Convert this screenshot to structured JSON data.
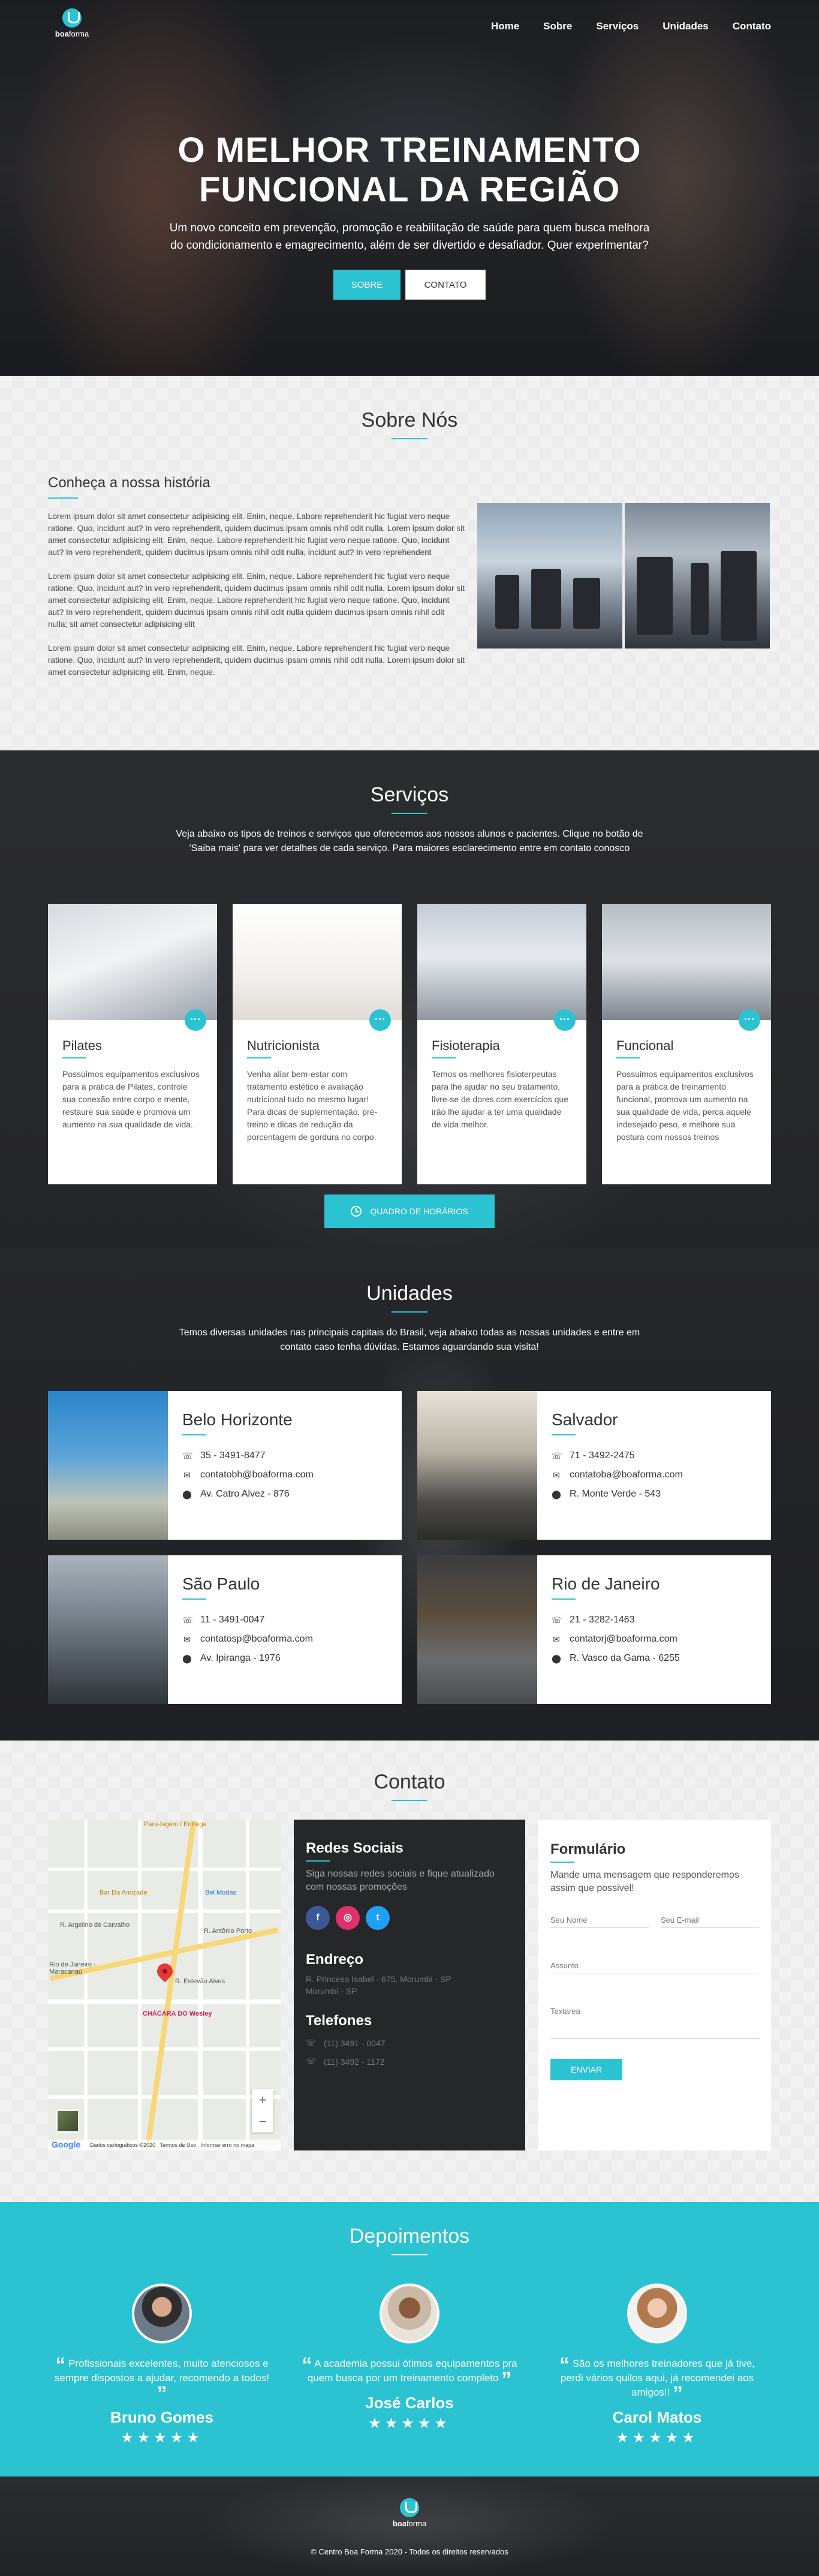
{
  "nav": {
    "logo_bold": "boa",
    "logo_regular": "forma",
    "items": [
      "Home",
      "Sobre",
      "Serviços",
      "Unidades",
      "Contato"
    ]
  },
  "hero": {
    "title_line1": "O MELHOR TREINAMENTO",
    "title_line2": "FUNCIONAL DA REGIÃO",
    "subtitle": "Um novo conceito em prevenção, promoção e reabilitação de saúde para quem busca melhora do condicionamento e emagrecimento, além de ser divertido e desafiador. Quer experimentar?",
    "btn_primary": "SOBRE",
    "btn_secondary": "CONTATO"
  },
  "sobre": {
    "title": "Sobre Nós",
    "subtitle": "Conheça a nossa história",
    "paragraphs": [
      "Lorem ipsum dolor sit amet consectetur adipisicing elit. Enim, neque. Labore reprehenderit hic fugiat vero neque ratione. Quo, incidunt aut? In vero reprehenderit, quidem ducimus ipsam omnis nihil odit nulla. Lorem ipsum dolor sit amet consectetur adipisicing elit. Enim, neque. Labore reprehenderit hic fugiat vero neque ratione. Quo, incidunt aut? In vero reprehenderit, quidem ducimus ipsam omnis nihil odit nulla, incidunt aut? In vero reprehendent",
      "Lorem ipsum dolor sit amet consectetur adipisicing elit. Enim, neque. Labore reprehenderit hic fugiat vero neque ratione. Quo, incidunt aut? In vero reprehenderit, quidem ducimus ipsam omnis nihil odit nulla. Lorem ipsum dolor sit amet consectetur adipisicing elit. Enim, neque. Labore reprehenderit hic fugiat vero neque ratione. Quo, incidunt aut? In vero reprehenderit, quidem ducimus ipsam omnis nihil odit nulla quidem ducimus ipsam omnis nihil odit nulla; sit amet consectetur adipisicing elit",
      "Lorem ipsum dolor sit amet consectetur adipisicing elit. Enim, neque. Labore reprehenderit hic fugiat vero neque ratione. Quo, incidunt aut? In vero reprehenderit, quidem ducimus ipsam omnis nihil odit nulla. Lorem ipsum dolor sit amet consectetur adipisicing elit. Enim, neque."
    ]
  },
  "servicos": {
    "title": "Serviços",
    "description": "Veja abaixo os tipos de treinos e serviços que oferecemos aos nossos alunos e pacientes. Clique no botão de 'Saiba mais' para ver detalhes de cada serviço. Para maiores esclarecimento entre em contato conosco",
    "more_icon": "···",
    "cards": [
      {
        "title": "Pilates",
        "text": "Possuimos equipamentos exclusivos para a prática de Pilates, controle sua conexão entre corpo e mente, restaure sua saúde e promova um aumento na sua qualidade de vida."
      },
      {
        "title": "Nutricionista",
        "text": "Venha aliar bem-estar com tratamento estético e avaliação nutricional tudo no mesmo lugar! Para dicas de suplementação, pré-treino e dicas de redução da porcentagem de gordura no corpo."
      },
      {
        "title": "Fisioterapia",
        "text": "Temos os melhores fisioterpeutas para lhe ajudar no seu tratamento, livre-se de dores com exercícios que irão lhe ajudar a ter uma qualidade de vida melhor."
      },
      {
        "title": "Funcional",
        "text": "Possuimos equipamentos exclusivos para a prática de treinamento funcional, promova um aumento na sua qualidade de vida, perca aquele indesejado peso, e melhore sua postura com nossos treinos"
      }
    ],
    "schedule_button": "QUADRO DE HORÁRIOS"
  },
  "unidades": {
    "title": "Unidades",
    "description": "Temos diversas unidades nas principais capitais do Brasil, veja abaixo todas as nossas unidades e entre em contato caso tenha dúvidas. Estamos aguardando sua visita!",
    "items": [
      {
        "city": "Belo Horizonte",
        "phone": "35 - 3491-8477",
        "email": "contatobh@boaforma.com",
        "address": "Av. Catro Alvez - 876"
      },
      {
        "city": "Salvador",
        "phone": "71 - 3492-2475",
        "email": "contatoba@boaforma.com",
        "address": "R. Monte Verde - 543"
      },
      {
        "city": "São Paulo",
        "phone": "11 - 3491-0047",
        "email": "contatosp@boaforma.com",
        "address": "Av. Ipiranga - 1976"
      },
      {
        "city": "Rio de Janeiro",
        "phone": "21 - 3282-1463",
        "email": "contatorj@boaforma.com",
        "address": "R. Vasco da Gama - 6255"
      }
    ]
  },
  "contato": {
    "title": "Contato",
    "map": {
      "labels": [
        "Para-lagem / Entrega",
        "Bar Da Amizade",
        "Bel Modas",
        "R. Argelino de Carvalho",
        "R. Antônio Porto",
        "Rio de Janeiro - Maracanaú",
        "R. Estevão Alves",
        "CHÁCARA DO Wesley",
        "Dados cartográficos ©2020",
        "Termos de Uso",
        "Informar erro no mapa",
        "Google"
      ],
      "zoom_in": "+",
      "zoom_out": "−"
    },
    "social": {
      "title": "Redes Sociais",
      "text": "Siga nossas redes sociais e fique atualizado com nossas promoções",
      "icons": [
        "facebook-icon",
        "instagram-icon",
        "twitter-icon"
      ],
      "icon_glyphs": [
        "f",
        "◎",
        "t"
      ],
      "address_title": "Endreço",
      "address_text": "R. Princesa Isabel - 675, Morumbi - SP\nMorumbi - SP",
      "phones_title": "Telefones",
      "phones": [
        "(11) 3491 - 0047",
        "(11) 3492 - 1172"
      ]
    },
    "form": {
      "title": "Formulário",
      "text": "Mande uma mensagem que responderemos assim que possivel!",
      "name_placeholder": "Seu Nome",
      "email_placeholder": "Seu E-mail",
      "subject_placeholder": "Assunto",
      "message_placeholder": "Textarea",
      "submit": "ENVIAR"
    }
  },
  "depoimentos": {
    "title": "Depoimentos",
    "items": [
      {
        "quote": "Profissionais excelentes, muito atenciosos e sempre dispostos a ajudar, recomendo a todos!",
        "name": "Bruno Gomes",
        "rating": 5
      },
      {
        "quote": "A academia possui ótimos equipamentos pra quem busca por um treinamento completo",
        "name": "José Carlos",
        "rating": 5
      },
      {
        "quote": "São os melhores treinadores que já tive, perdi vários quilos aqui, já recomendei aos amigos!!",
        "name": "Carol Matos",
        "rating": 5
      }
    ],
    "stars": "★★★★★"
  },
  "footer": {
    "logo_bold": "boa",
    "logo_regular": "forma",
    "copyright": "© Centro Boa Forma 2020 - Todos os direitos reservados"
  },
  "colors": {
    "accent": "#2bc3d2",
    "dark": "#262729"
  }
}
